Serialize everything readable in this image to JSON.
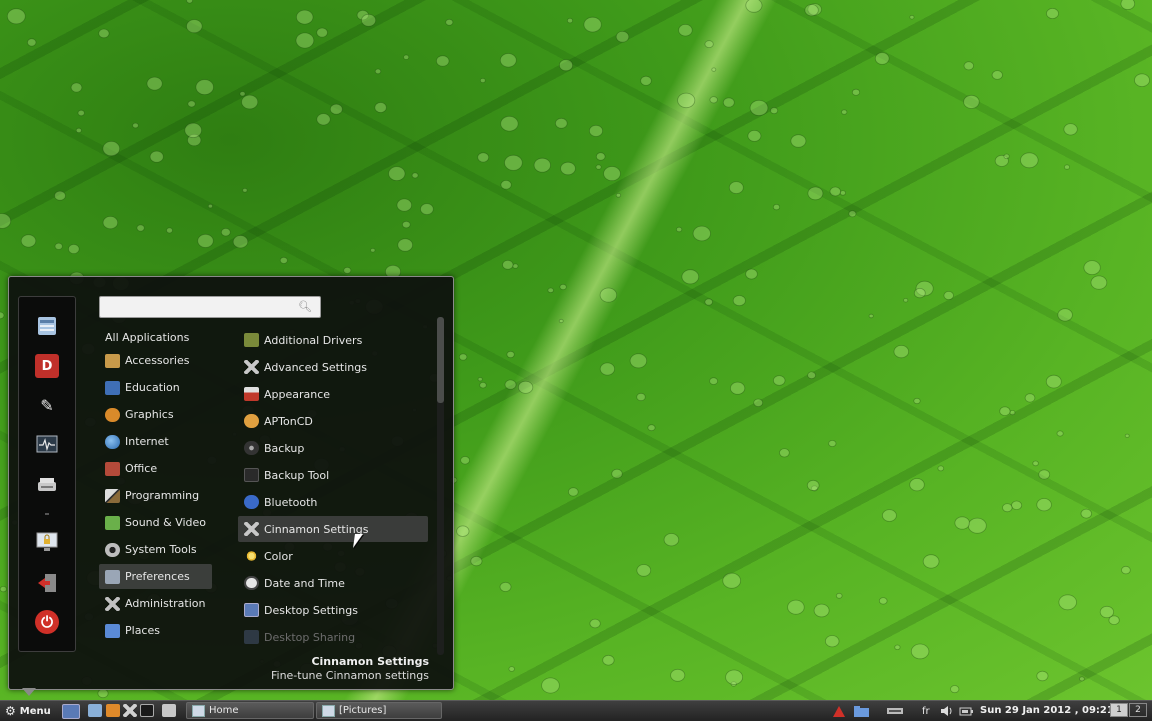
{
  "search": {
    "value": "",
    "placeholder": ""
  },
  "categories": [
    {
      "label": "All Applications",
      "icon": "none",
      "color": ""
    },
    {
      "label": "Accessories",
      "icon": "accessories-icon",
      "color": "#c89a4a"
    },
    {
      "label": "Education",
      "icon": "education-icon",
      "color": "#3f6fb6"
    },
    {
      "label": "Graphics",
      "icon": "graphics-icon",
      "color": "#d98a2a"
    },
    {
      "label": "Internet",
      "icon": "internet-icon",
      "color": "#4a8ac8"
    },
    {
      "label": "Office",
      "icon": "office-icon",
      "color": "#b44a3a"
    },
    {
      "label": "Programming",
      "icon": "programming-icon",
      "color": "#a0a0a0"
    },
    {
      "label": "Sound & Video",
      "icon": "sound-video-icon",
      "color": "#6ab04a"
    },
    {
      "label": "System Tools",
      "icon": "system-tools-icon",
      "color": "#bdbdbd"
    },
    {
      "label": "Preferences",
      "icon": "preferences-icon",
      "color": "#9aa6b6"
    },
    {
      "label": "Administration",
      "icon": "administration-icon",
      "color": "#c0c0c0"
    },
    {
      "label": "Places",
      "icon": "folder-icon",
      "color": "#5a8ad6"
    }
  ],
  "active_category": "Preferences",
  "apps": [
    {
      "label": "Additional Drivers",
      "icon": "drivers-icon",
      "color": "#7a8a3a"
    },
    {
      "label": "Advanced Settings",
      "icon": "tools-icon",
      "color": "#c8c8c8"
    },
    {
      "label": "Appearance",
      "icon": "appearance-icon",
      "color": "#c0392b"
    },
    {
      "label": "APTonCD",
      "icon": "aptoncd-icon",
      "color": "#e0a040"
    },
    {
      "label": "Backup",
      "icon": "backup-icon",
      "color": "#555555"
    },
    {
      "label": "Backup Tool",
      "icon": "backup-tool-icon",
      "color": "#2a2a2a"
    },
    {
      "label": "Bluetooth",
      "icon": "bluetooth-icon",
      "color": "#3a6ac8"
    },
    {
      "label": "Cinnamon Settings",
      "icon": "tools-icon",
      "color": "#c8c8c8"
    },
    {
      "label": "Color",
      "icon": "color-icon",
      "color": "#e8b830"
    },
    {
      "label": "Date and Time",
      "icon": "clock-icon",
      "color": "#e6e6e6"
    },
    {
      "label": "Desktop Settings",
      "icon": "desktop-icon",
      "color": "#5a7ab6"
    },
    {
      "label": "Desktop Sharing",
      "icon": "desktop-sharing-icon",
      "color": "#4a5a7a"
    }
  ],
  "hovered_app": "Cinnamon Settings",
  "description": {
    "title": "Cinnamon Settings",
    "text": "Fine-tune Cinnamon settings"
  },
  "favorites": [
    {
      "name": "file-manager-icon",
      "glyph": "",
      "color": "#8ab0d8"
    },
    {
      "name": "dictionary-icon",
      "glyph": "D",
      "color": "#c0302a"
    },
    {
      "name": "text-editor-icon",
      "glyph": "✎",
      "color": "#4a4a4a"
    },
    {
      "name": "system-monitor-icon",
      "glyph": "",
      "color": "#3a4a5a"
    },
    {
      "name": "scanner-icon",
      "glyph": "",
      "color": "#b8b8b8"
    },
    {
      "name": "lock-screen-icon",
      "glyph": "",
      "color": "#7a8a9a"
    },
    {
      "name": "logout-icon",
      "glyph": "",
      "color": "#c0302a"
    },
    {
      "name": "power-icon",
      "glyph": "⏻",
      "color": "#d03028"
    }
  ],
  "taskbar": {
    "menu_label": "Menu",
    "windows": [
      {
        "label": "Home"
      },
      {
        "label": "[Pictures]"
      }
    ],
    "keyboard_layout": "fr",
    "clock": "Sun 29 Jan 2012 , 09:21",
    "workspaces": [
      "1",
      "2"
    ],
    "active_workspace": "1"
  }
}
